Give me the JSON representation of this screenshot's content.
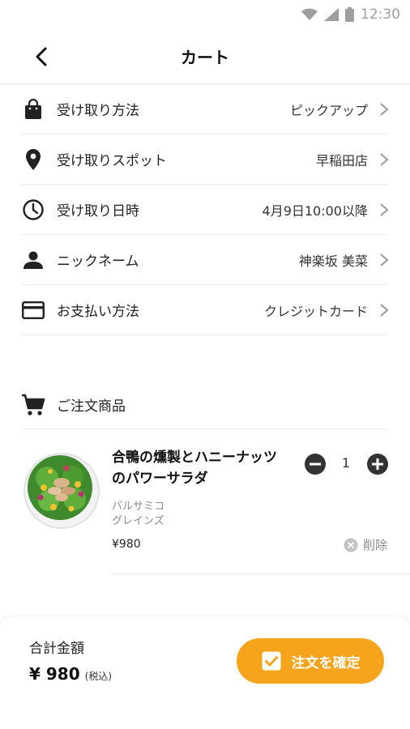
{
  "status_bar": {
    "time": "12:30"
  },
  "app_bar": {
    "title": "カート"
  },
  "settings": [
    {
      "label": "受け取り方法",
      "value": "ピックアップ",
      "icon": "shopping-bag-icon"
    },
    {
      "label": "受け取りスポット",
      "value": "早稲田店",
      "icon": "location-pin-icon"
    },
    {
      "label": "受け取り日時",
      "value": "4月9日10:00以降",
      "icon": "clock-icon"
    },
    {
      "label": "ニックネーム",
      "value": "神楽坂 美菜",
      "icon": "person-icon"
    },
    {
      "label": "お支払い方法",
      "value": "クレジットカード",
      "icon": "credit-card-icon"
    }
  ],
  "order_section": {
    "title": "ご注文商品",
    "icon": "cart-icon"
  },
  "cart_item": {
    "name": "合鴨の燻製とハニーナッツのパワーサラダ",
    "options": [
      "バルサミコ",
      "グレインズ"
    ],
    "price": "¥980",
    "quantity": "1",
    "delete_label": "削除"
  },
  "footer": {
    "total_label": "合計金額",
    "total_amount": "¥ 980",
    "tax_note": "(税込)",
    "confirm_label": "注文を確定"
  },
  "colors": {
    "accent": "#f6a41c",
    "icon_dark": "#222222",
    "muted": "#8a8a8a"
  }
}
